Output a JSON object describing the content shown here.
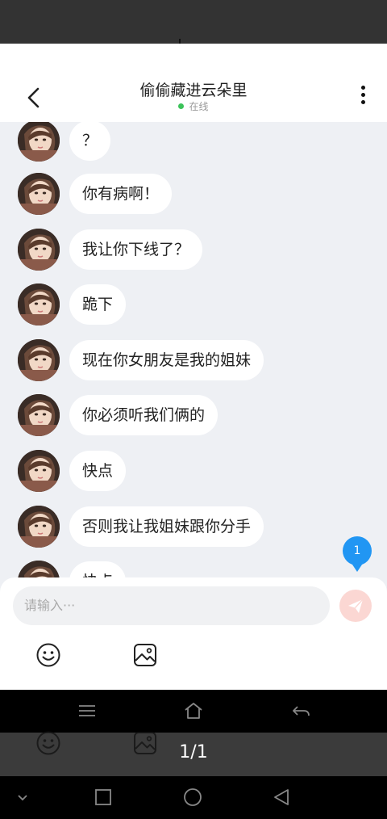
{
  "chat": {
    "title": "偷偷藏进云朵里",
    "status": "在线",
    "messages": [
      {
        "text": "？"
      },
      {
        "text": "你有病啊！"
      },
      {
        "text": "我让你下线了？"
      },
      {
        "text": "跪下"
      },
      {
        "text": "现在你女朋友是我的姐妹"
      },
      {
        "text": "你必须听我们俩的"
      },
      {
        "text": "快点"
      },
      {
        "text": "否则我让我姐妹跟你分手"
      },
      {
        "text": "快点"
      }
    ],
    "unread_count": "1"
  },
  "composer": {
    "placeholder": "请输入···"
  },
  "viewer": {
    "page_indicator": "1/1"
  },
  "colors": {
    "accent": "#2196f3",
    "online": "#3cc35a",
    "send": "#fbd7d3",
    "chat_bg": "#eef0f4"
  },
  "icons": {
    "back": "chevron-left-icon",
    "more": "more-vertical-icon",
    "send": "send-icon",
    "emoji": "emoji-icon",
    "image": "image-icon"
  }
}
